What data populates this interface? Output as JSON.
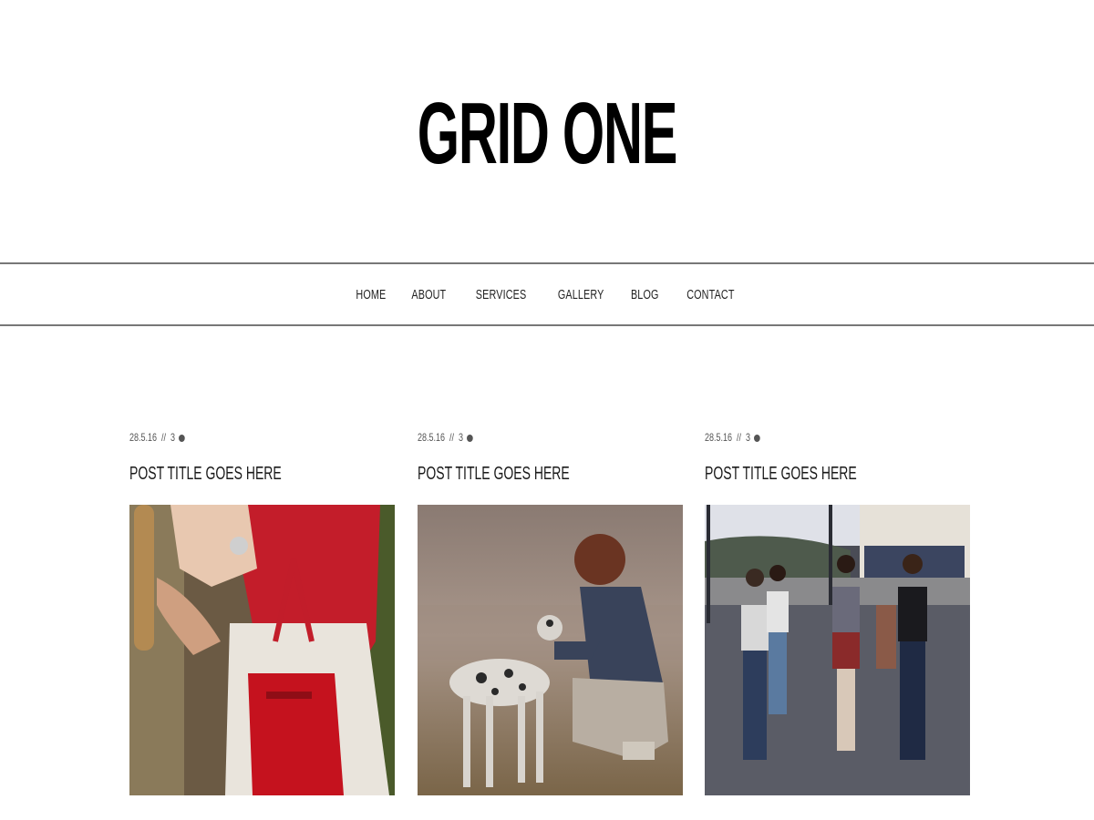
{
  "site": {
    "title": "GRID ONE"
  },
  "nav": {
    "items": [
      "HOME",
      "ABOUT",
      "SERVICES",
      "GALLERY",
      "BLOG",
      "CONTACT"
    ]
  },
  "posts": [
    {
      "date": "28.5.16",
      "separator": "//",
      "comments": "3",
      "title": "POST TITLE GOES HERE",
      "image": "woman-red-handbag-photo"
    },
    {
      "date": "28.5.16",
      "separator": "//",
      "comments": "3",
      "title": "POST TITLE GOES HERE",
      "image": "woman-with-dog-photo"
    },
    {
      "date": "28.5.16",
      "separator": "//",
      "comments": "3",
      "title": "POST TITLE GOES HERE",
      "image": "friends-walking-photo"
    }
  ],
  "colors": {
    "text": "#111111",
    "divider": "#777777",
    "background": "#ffffff"
  }
}
